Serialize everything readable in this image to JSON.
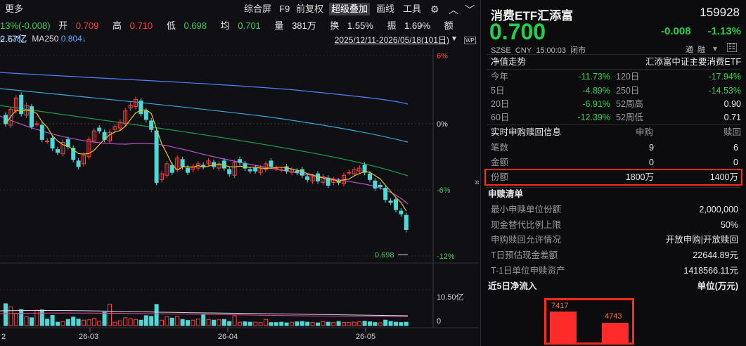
{
  "toolbar": {
    "more": "更多",
    "buttons": [
      "综合屏",
      "F9",
      "前复权",
      "超级叠加",
      "画线",
      "工具"
    ],
    "selected": "超级叠加",
    "icons": [
      "gear-icon",
      "chevron-up-icon",
      "chevron-down-icon"
    ]
  },
  "quote_line": {
    "change": "13%(-0.008)",
    "open_label": "开",
    "open": "0.709",
    "high_label": "高",
    "high": "0.710",
    "low_label": "低",
    "low": "0.698",
    "avg_label": "均",
    "avg": "0.701",
    "volume_label": "量",
    "volume": "381万",
    "turnover_label": "换",
    "turnover": "1.55%",
    "amplitude_label": "振",
    "amplitude": "1.69%",
    "amount_label": "额",
    "amount": "2.67亿"
  },
  "ma_line": {
    "ma_prev": "0.778↓",
    "ma250_label": "MA250",
    "ma250": "0.804↓"
  },
  "date_range": "2025/12/11-2026/05/18(101日)",
  "wp_badge": "WP",
  "price_axis": [
    "6%",
    "0%",
    "-6%",
    "-12%"
  ],
  "last_price_marker": "0.698",
  "volume_axis": [
    "10.50亿",
    "0"
  ],
  "x_axis": [
    "2",
    "26-03",
    "26-04",
    "26-05"
  ],
  "chart_data": [
    {
      "type": "line",
      "note_type": "candlestick",
      "title": "",
      "x": [
        "26-03",
        "26-04",
        "26-05"
      ],
      "ylim_percent": [
        -12,
        6
      ],
      "series": [
        {
          "name": "close",
          "values": [
            0.772,
            0.782,
            0.79,
            0.779,
            0.785,
            0.77,
            0.772,
            0.761,
            0.76,
            0.755,
            0.752,
            0.759,
            0.756,
            0.747,
            0.742,
            0.75,
            0.761,
            0.767,
            0.767,
            0.761,
            0.766,
            0.77,
            0.773,
            0.781,
            0.785,
            0.789,
            0.779,
            0.775,
            0.768,
            0.731,
            0.737,
            0.744,
            0.738,
            0.748,
            0.742,
            0.738,
            0.742,
            0.744,
            0.742,
            0.746,
            0.742,
            0.744,
            0.741,
            0.737,
            0.745,
            0.745,
            0.741,
            0.739,
            0.739,
            0.741,
            0.744,
            0.742,
            0.741,
            0.74,
            0.739,
            0.74,
            0.738,
            0.736,
            0.733,
            0.735,
            0.732,
            0.735,
            0.729,
            0.733,
            0.731,
            0.736,
            0.738,
            0.74,
            0.741,
            0.738,
            0.733,
            0.727,
            0.728,
            0.719,
            0.717,
            0.712,
            0.709,
            0.698
          ]
        }
      ]
    },
    {
      "type": "bar",
      "title": "",
      "ylabel": "",
      "ylim": [
        0,
        10.5
      ],
      "values": [
        6.4,
        5.5,
        3.5,
        4.7,
        2.6,
        2.3,
        4.5,
        4.6,
        1.9,
        3.0,
        1.0,
        1.2,
        1.8,
        2.5,
        1.9,
        1.6,
        1.7,
        2.1,
        1.3,
        3.9,
        6.3,
        1.0,
        1.4,
        2.3,
        2.0,
        1.8,
        1.6,
        2.9,
        2.7,
        6.2,
        1.6,
        2.6,
        2.2,
        2.7,
        1.8,
        1.5,
        1.6,
        1.9,
        3.3,
        1.8,
        1.6,
        1.7,
        1.8,
        1.2,
        2.9,
        1.0,
        1.1,
        1.0,
        1.0,
        0.9,
        1.8,
        0.9,
        0.9,
        1.0,
        0.8,
        1.0,
        1.1,
        1.2,
        1.0,
        0.9,
        0.8,
        1.2,
        1.0,
        0.9,
        1.2,
        0.9,
        0.9,
        1.0,
        1.1,
        1.3,
        1.1,
        0.9,
        0.8,
        1.6,
        1.2,
        1.0,
        0.9,
        1.0
      ]
    },
    {
      "type": "bar",
      "title": "近5日净流入",
      "ylabel": "单位(万元)",
      "categories": [
        "",
        ""
      ],
      "values": [
        7417,
        4743
      ]
    }
  ],
  "fund": {
    "name": "消费ETF汇添富",
    "code": "159928",
    "price": "0.700",
    "change": "-0.008",
    "change_pct": "-1.13%",
    "market": "SZSE",
    "currency": "CNY",
    "time": "15:00:03",
    "status": "闭市",
    "tags": [
      "通",
      "融"
    ]
  },
  "nav": {
    "title": "净值走势",
    "index": "汇添富中证主要消费ETF",
    "rows": [
      {
        "l1": "今年",
        "v1": "-11.73%",
        "l2": "120日",
        "v2": "-17.94%"
      },
      {
        "l1": "5日",
        "v1": "-4.89%",
        "l2": "250日",
        "v2": "-14.53%"
      },
      {
        "l1": "20日",
        "v1": "-6.91%",
        "l2": "52周高",
        "v2": "0.90"
      },
      {
        "l1": "60日",
        "v1": "-12.39%",
        "l2": "52周低",
        "v2": "0.71"
      }
    ]
  },
  "realtime": {
    "title": "实时申购赎回信息",
    "col_buy": "申购",
    "col_redeem": "赎回",
    "rows": [
      {
        "label": "笔数",
        "buy": "9",
        "redeem": "6"
      },
      {
        "label": "金额",
        "buy": "0",
        "redeem": "0"
      },
      {
        "label": "份额",
        "buy": "1800万",
        "redeem": "1400万"
      }
    ]
  },
  "creation": {
    "title": "申赎清单",
    "rows": [
      {
        "label": "最小申赎单位份额",
        "value": "2,000,000"
      },
      {
        "label": "现金替代比例上限",
        "value": "50%"
      },
      {
        "label": "申购赎回允许情况",
        "value": "开放申购|开放赎回"
      },
      {
        "label": "T日预估现金差额",
        "value": "22644.89元"
      },
      {
        "label": "T-1日单位申赎资产",
        "value": "1418566.11元"
      }
    ]
  },
  "inflow": {
    "title": "近5日净流入",
    "unit": "单位(万元)",
    "labels": [
      "7417",
      "4743"
    ]
  },
  "colors": {
    "up": "#ff4040",
    "down": "#33d05a",
    "accent_box": "#ff2a1a",
    "candle_down": "#4fd8d8"
  }
}
